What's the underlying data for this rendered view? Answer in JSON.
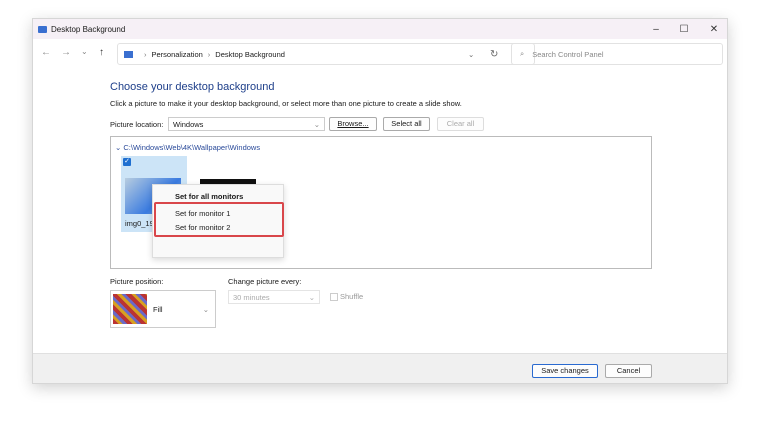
{
  "window": {
    "title": "Desktop Background",
    "minimize": "–",
    "maximize": "☐",
    "close": "✕"
  },
  "nav": {
    "back": "←",
    "forward": "→",
    "recent": "⌄",
    "up": "↑",
    "breadcrumb": [
      "Personalization",
      "Desktop Background"
    ],
    "refresh": "↻",
    "dropdown": "⌄",
    "search_placeholder": "Search Control Panel"
  },
  "main": {
    "heading": "Choose your desktop background",
    "subtitle": "Click a picture to make it your desktop background, or select more than one picture to create a slide show.",
    "location_label": "Picture location:",
    "location_value": "Windows",
    "browse": "Browse...",
    "select_all": "Select all",
    "clear_all": "Clear all",
    "folder_path": "C:\\Windows\\Web\\4K\\Wallpaper\\Windows",
    "image_label": "img0_19",
    "context_menu": [
      "Set for all monitors",
      "Set for monitor 1",
      "Set for monitor 2"
    ],
    "position_label": "Picture position:",
    "position_value": "Fill",
    "interval_label": "Change picture every:",
    "interval_value": "30 minutes",
    "shuffle": "Shuffle"
  },
  "footer": {
    "save": "Save changes",
    "cancel": "Cancel"
  }
}
